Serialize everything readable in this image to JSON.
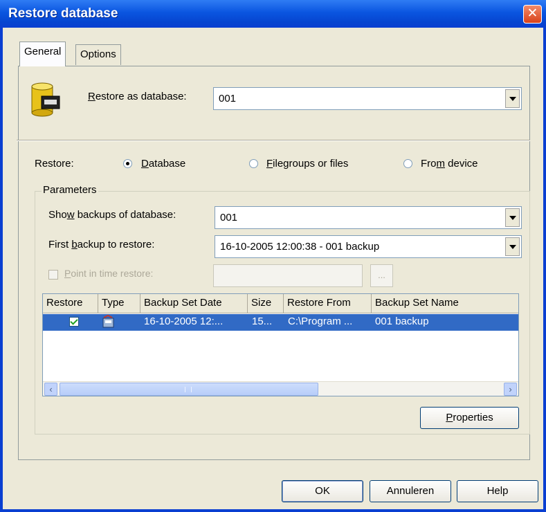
{
  "window": {
    "title": "Restore database",
    "close": "✕"
  },
  "tabs": [
    {
      "label": "General",
      "active": true
    },
    {
      "label": "Options",
      "active": false
    }
  ],
  "restore_as": {
    "label_pre": "",
    "label_u": "R",
    "label_post": "estore as database:",
    "value": "001"
  },
  "restore_type": {
    "label": "Restore:",
    "options": [
      {
        "u": "D",
        "rest": "atabase",
        "pre": "",
        "checked": true
      },
      {
        "pre": "",
        "u": "F",
        "rest": "ilegroups or files",
        "checked": false
      },
      {
        "pre": "Fro",
        "u": "m",
        "rest": " device",
        "checked": false
      }
    ]
  },
  "parameters": {
    "legend": "Parameters",
    "show_backups": {
      "pre": "Sho",
      "u": "w",
      "post": " backups of database:",
      "value": "001"
    },
    "first_backup": {
      "pre": "First ",
      "u": "b",
      "post": "ackup to restore:",
      "value": "16-10-2005 12:00:38 - 001 backup"
    },
    "point_in_time": {
      "pre": "",
      "u": "P",
      "post": "oint in time restore:",
      "value": "",
      "button": "..."
    }
  },
  "grid": {
    "columns": [
      "Restore",
      "Type",
      "Backup Set Date",
      "Size",
      "Restore From",
      "Backup Set Name"
    ],
    "rows": [
      {
        "restore": true,
        "type": "",
        "date": "16-10-2005 12:...",
        "size": "15...",
        "from": "C:\\Program ...",
        "name": "001 backup"
      }
    ],
    "scroll_left": "‹",
    "scroll_right": "›"
  },
  "buttons": {
    "properties": {
      "u": "P",
      "rest": "roperties"
    },
    "ok": "OK",
    "cancel": "Annuleren",
    "help": "Help"
  },
  "colors": {
    "titlebar": "#0a55e0",
    "selection": "#316ac5",
    "dialog": "#ece9d8"
  }
}
